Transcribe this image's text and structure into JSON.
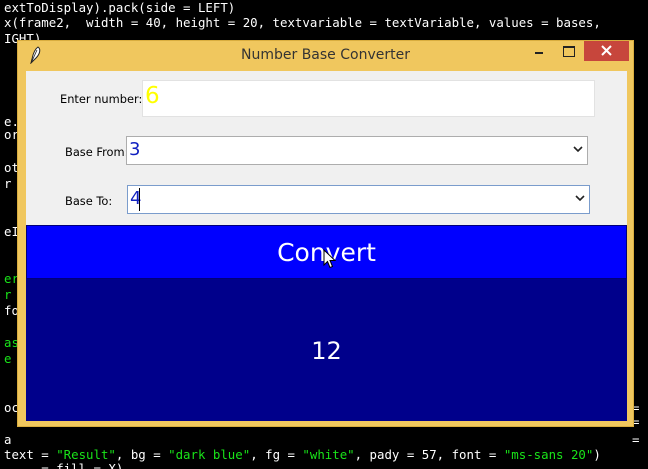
{
  "editor": {
    "lines": [
      {
        "text": "extToDisplay).pack(side = LEFT)",
        "green": false
      },
      {
        "text": "x(frame2,  width = 40, height = 20, textvariable = textVariable, values = bases,",
        "green": false
      },
      {
        "text": "IGHT)",
        "green": false
      },
      {
        "text": "e.",
        "green": false
      },
      {
        "text": "or",
        "green": false
      },
      {
        "text": "ot",
        "green": false
      },
      {
        "text": "r",
        "green": false
      },
      {
        "text": "eI",
        "green": false
      },
      {
        "text": "er",
        "green": true
      },
      {
        "text": "r",
        "green": true
      },
      {
        "text": "fo",
        "green": false
      },
      {
        "text": "as",
        "green": true
      },
      {
        "text": "e",
        "green": true
      },
      {
        "text": "oc",
        "green": false
      },
      {
        "text": "=",
        "green": false
      },
      {
        "text": "a",
        "green": false
      },
      {
        "text": "=",
        "green": false
      },
      {
        "text": "=",
        "green": false
      }
    ],
    "bottom_line": [
      {
        "text": "text = ",
        "kind": "plain"
      },
      {
        "text": "\"Result\"",
        "kind": "str"
      },
      {
        "text": ", bg = ",
        "kind": "plain"
      },
      {
        "text": "\"dark blue\"",
        "kind": "str"
      },
      {
        "text": ", fg = ",
        "kind": "plain"
      },
      {
        "text": "\"white\"",
        "kind": "str"
      },
      {
        "text": ", pady = 57, font = ",
        "kind": "plain"
      },
      {
        "text": "\"ms-sans 20\"",
        "kind": "str"
      },
      {
        "text": ")",
        "kind": "plain"
      }
    ],
    "last_line": "     = fill = X)"
  },
  "window": {
    "title": "Number Base Converter",
    "frame_color": "#f0c75e",
    "close_color": "#c7463c"
  },
  "form": {
    "number_label": "Enter number:",
    "number_value": "6",
    "base_from_label": "Base From:",
    "base_from_value": "3",
    "base_to_label": "Base To:",
    "base_to_value": "4"
  },
  "convert_button": {
    "label": "Convert",
    "bg": "#0000ff"
  },
  "result": {
    "value": "12",
    "bg": "#00008b"
  },
  "icons": [
    "feather-icon",
    "minimize-icon",
    "maximize-icon",
    "close-icon",
    "chevron-down-icon",
    "mouse-pointer-icon"
  ]
}
